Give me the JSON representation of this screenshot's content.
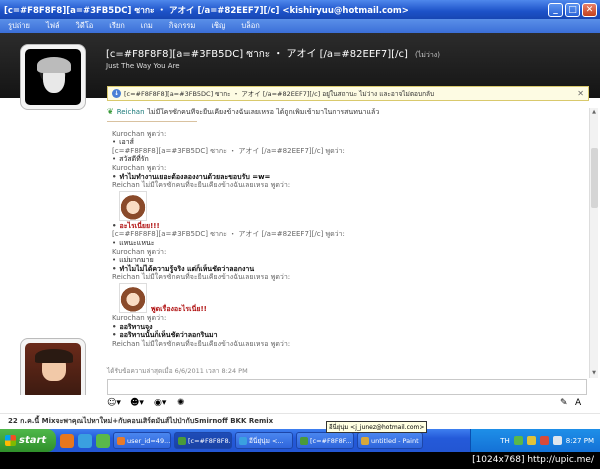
{
  "window": {
    "title": "[c=#F8F8F8][a=#3FB5DC] ซากะ ・ アオイ [/a=#82EEF7][/c] <kishiryuu@hotmail.com>",
    "minimize": "_",
    "maximize": "□",
    "close": "✕"
  },
  "menu": [
    "รูปถ่าย",
    "ไฟล์",
    "วิดีโอ",
    "เรียก",
    "เกม",
    "กิจกรรม",
    "เชิญ",
    "บล็อก"
  ],
  "contact": {
    "name": "[c=#F8F8F8][a=#3FB5DC] ซากะ ・ アオイ [/a=#82EEF7][/c]",
    "status": "(ไม่ว่าง)",
    "psm": "Just The Way You Are"
  },
  "infobar": {
    "text": "[c=#F8F8F8][a=#3FB5DC] ซากะ ・ アオイ [/a=#82EEF7][/c] อยู่ในสถานะ ไม่ว่าง และอาจไม่ตอบกลับ",
    "close": "✕"
  },
  "system_message": {
    "name": "Reichan",
    "text": "ไม่มีใครซักคนที่จะยืนเคียงข้างฉันเลยเหรอ ได้ถูกเพิ่มเข้ามาในการสนทนาแล้ว"
  },
  "messages": [
    {
      "who": "Kurochan พูดว่า:",
      "lines": [
        {
          "text": "เอาส์",
          "style": ""
        }
      ]
    },
    {
      "who": "[c=#F8F8F8][a=#3FB5DC] ซากะ ・ アオイ [/a=#82EEF7][/c] พูดว่า:",
      "lines": [
        {
          "text": "สวัสดีที่รัก",
          "style": ""
        }
      ]
    },
    {
      "who": "Kurochan พูดว่า:",
      "lines": [
        {
          "text": "ทำไมทำงานเยอะต้องลองงานด้วยละขอบรับ =w=",
          "style": "bold"
        }
      ]
    },
    {
      "who": "Reichan ไม่มีใครซักคนที่จะยืนเคียงข้างฉันเลยเหรอ พูดว่า:",
      "emote": true,
      "emote_text": "",
      "lines": [
        {
          "text": "อะไรเนี่ยย!!!",
          "style": "red"
        }
      ]
    },
    {
      "who": "[c=#F8F8F8][a=#3FB5DC] ซากะ ・ アオイ [/a=#82EEF7][/c] พูดว่า:",
      "lines": [
        {
          "text": "แหนะแหนะ",
          "style": ""
        }
      ]
    },
    {
      "who": "Kurochan พูดว่า:",
      "lines": [
        {
          "text": "แม่มากมาย",
          "style": ""
        },
        {
          "text": "ทำไมไม่ได้ความรู้จริง แต่ก็เห็นชัดว่าลอกงาน",
          "style": "bold"
        }
      ]
    },
    {
      "who": "Reichan ไม่มีใครซักคนที่จะยืนเคียงข้างฉันเลยเหรอ พูดว่า:",
      "emote": true,
      "emote_text": "พูดเรื่องอะไรเนี่ย!!",
      "lines": []
    },
    {
      "who": "Kurochan พูดว่า:",
      "lines": [
        {
          "text": "ออริทานจง",
          "style": "bold"
        },
        {
          "text": "ออริทานนั้นก็เห็นชัดว่าลอกรินมา",
          "style": "bold"
        }
      ]
    },
    {
      "who": "Reichan ไม่มีใครซักคนที่จะยืนเคียงข้างฉันเลยเหรอ พูดว่า:",
      "lines": []
    }
  ],
  "last_message": "ได้รับข้อความล่าสุดเมื่อ 6/6/2011 เวลา 8:24 PM",
  "now_playing": "22 ก.ค.นี้ Mixจะพาคุณไปหาใหม่+กับคอนเสิร์ตมันส์ไปป่ากับSmirnoff BKK Remix",
  "taskbar": {
    "start": "start",
    "tasks": [
      {
        "label": "user_id=49...",
        "color": "#e87a2a",
        "active": false
      },
      {
        "label": "[c=#F8F8F8...",
        "color": "#4a9a3a",
        "active": true
      },
      {
        "label": "อีนี่ยุ่นุ่ม <...",
        "color": "#3aa0e0",
        "active": false
      },
      {
        "label": "[c=#F8F8F...",
        "color": "#4a9a3a",
        "active": false
      },
      {
        "label": "untitled - Paint",
        "color": "#d8a83a",
        "active": false
      }
    ],
    "tooltip": "อีนี่ยุ่นุ่ม <j_junez@hotmail.com>",
    "lang": "TH",
    "clock": "8:27 PM"
  },
  "watermark": "[1024x768] http://upic.me/"
}
